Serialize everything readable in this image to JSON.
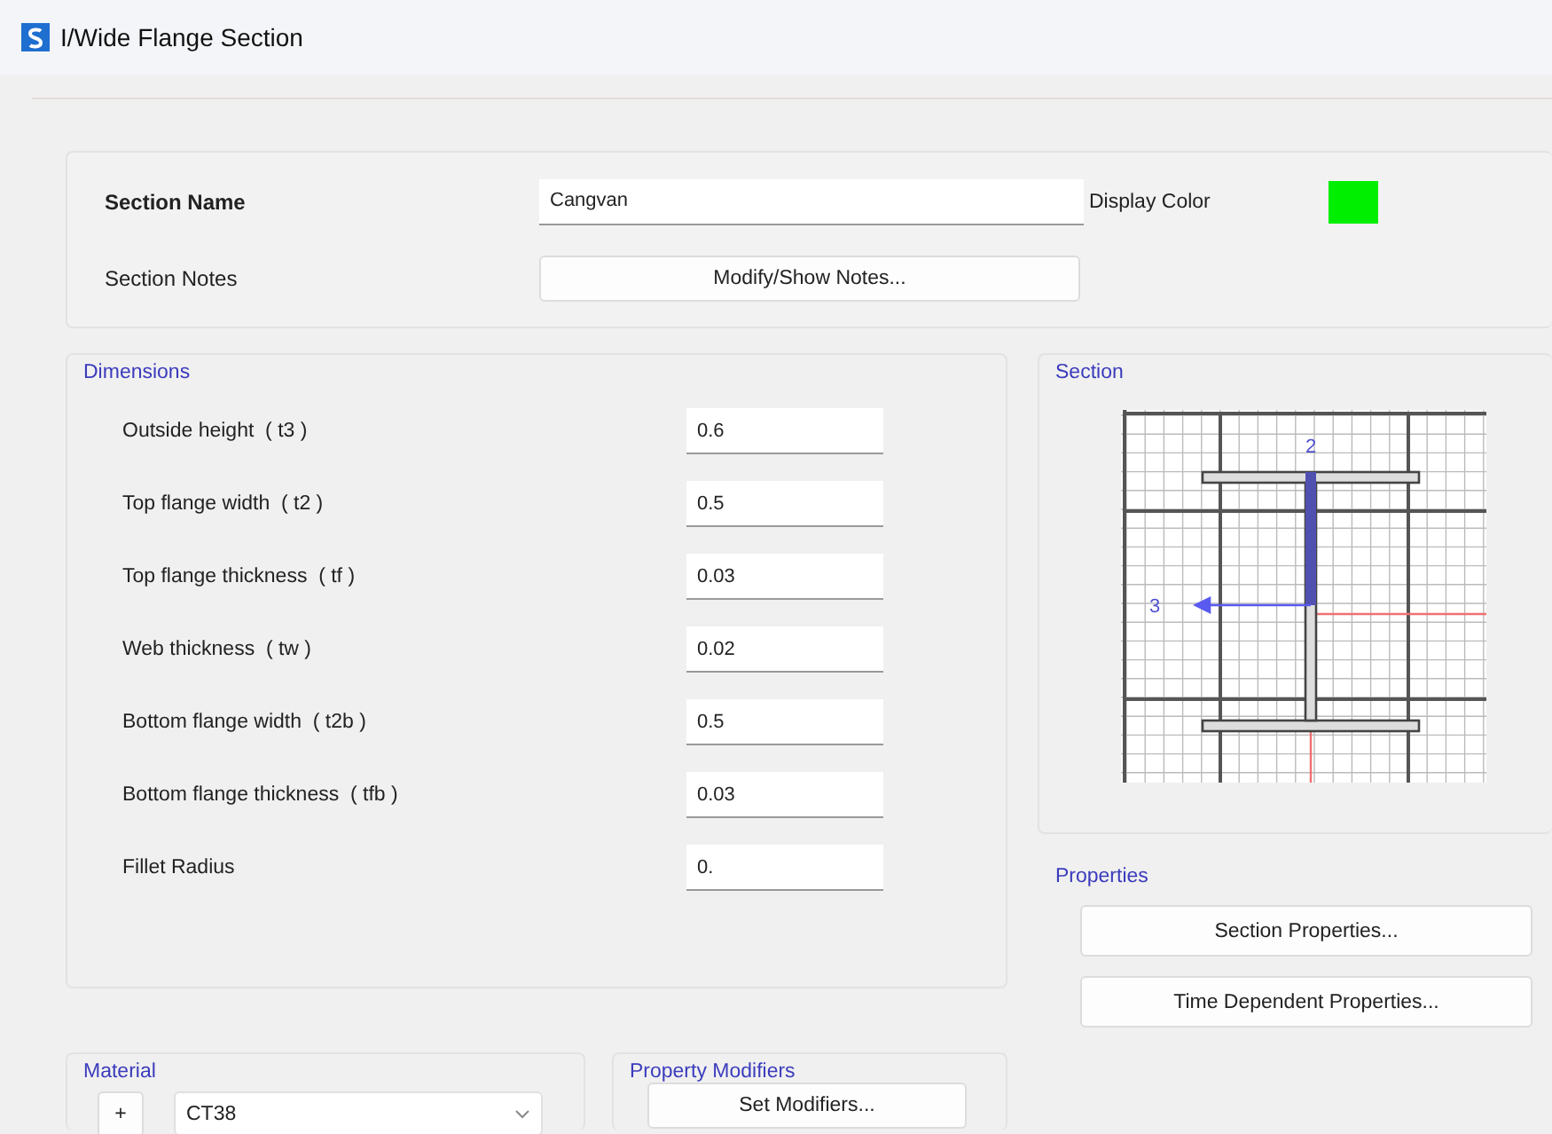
{
  "window": {
    "title": "I/Wide Flange Section"
  },
  "section_name": {
    "label": "Section Name",
    "value": "Cangvan"
  },
  "section_notes": {
    "label": "Section Notes",
    "button": "Modify/Show Notes..."
  },
  "display_color": {
    "label": "Display Color",
    "color": "#00ee00"
  },
  "dimensions": {
    "title": "Dimensions",
    "rows": [
      {
        "label": "Outside height  ( t3 )",
        "value": "0.6"
      },
      {
        "label": "Top flange width  ( t2 )",
        "value": "0.5"
      },
      {
        "label": "Top flange thickness  ( tf )",
        "value": "0.03"
      },
      {
        "label": "Web thickness  ( tw )",
        "value": "0.02"
      },
      {
        "label": "Bottom flange width  ( t2b )",
        "value": "0.5"
      },
      {
        "label": "Bottom flange thickness  ( tfb )",
        "value": "0.03"
      },
      {
        "label": "Fillet Radius",
        "value": "0."
      }
    ]
  },
  "section": {
    "title": "Section",
    "axis_vertical": "2",
    "axis_horizontal": "3"
  },
  "properties": {
    "title": "Properties",
    "buttons": [
      "Section Properties...",
      "Time Dependent Properties..."
    ]
  },
  "material": {
    "title": "Material",
    "add_button": "+",
    "value": "CT38"
  },
  "property_modifiers": {
    "title": "Property Modifiers",
    "button": "Set Modifiers..."
  }
}
